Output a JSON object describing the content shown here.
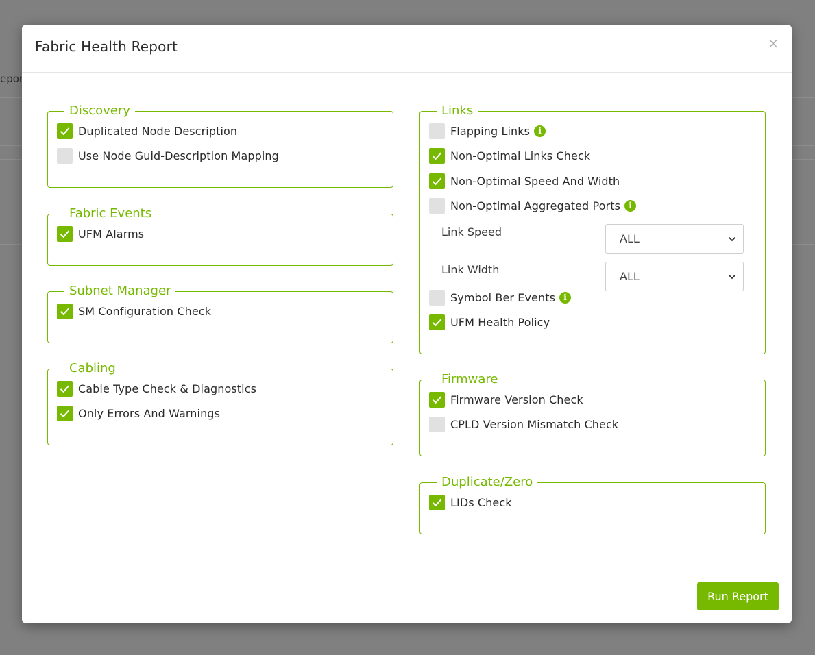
{
  "background": {
    "partial_text": "epor"
  },
  "modal": {
    "title": "Fabric Health Report",
    "close_symbol": "×",
    "run_label": "Run Report"
  },
  "colors": {
    "accent": "#76b900",
    "unchecked": "#e1e1e1",
    "backdrop": "#808080"
  },
  "groups": {
    "discovery": {
      "title": "Discovery",
      "items": [
        {
          "label": "Duplicated Node Description",
          "checked": true
        },
        {
          "label": "Use Node Guid-Description Mapping",
          "checked": false
        }
      ]
    },
    "fabric_events": {
      "title": "Fabric Events",
      "items": [
        {
          "label": "UFM Alarms",
          "checked": true
        }
      ]
    },
    "subnet_manager": {
      "title": "Subnet Manager",
      "items": [
        {
          "label": "SM Configuration Check",
          "checked": true
        }
      ]
    },
    "cabling": {
      "title": "Cabling",
      "items": [
        {
          "label": "Cable Type Check & Diagnostics",
          "checked": true
        },
        {
          "label": "Only Errors And Warnings",
          "checked": true
        }
      ]
    },
    "links": {
      "title": "Links",
      "items": [
        {
          "label": "Flapping Links",
          "checked": false,
          "info": true
        },
        {
          "label": "Non-Optimal Links Check",
          "checked": true
        },
        {
          "label": "Non-Optimal Speed And Width",
          "checked": true
        },
        {
          "label": "Non-Optimal Aggregated Ports",
          "checked": false,
          "info": true
        },
        {
          "label": "Symbol Ber Events",
          "checked": false,
          "info": true
        },
        {
          "label": "UFM Health Policy",
          "checked": true
        }
      ],
      "link_speed": {
        "label": "Link Speed",
        "value": "ALL"
      },
      "link_width": {
        "label": "Link Width",
        "value": "ALL"
      }
    },
    "firmware": {
      "title": "Firmware",
      "items": [
        {
          "label": "Firmware Version Check",
          "checked": true
        },
        {
          "label": "CPLD Version Mismatch Check",
          "checked": false
        }
      ]
    },
    "duplicate_zero": {
      "title": "Duplicate/Zero",
      "items": [
        {
          "label": "LIDs Check",
          "checked": true
        }
      ]
    }
  }
}
